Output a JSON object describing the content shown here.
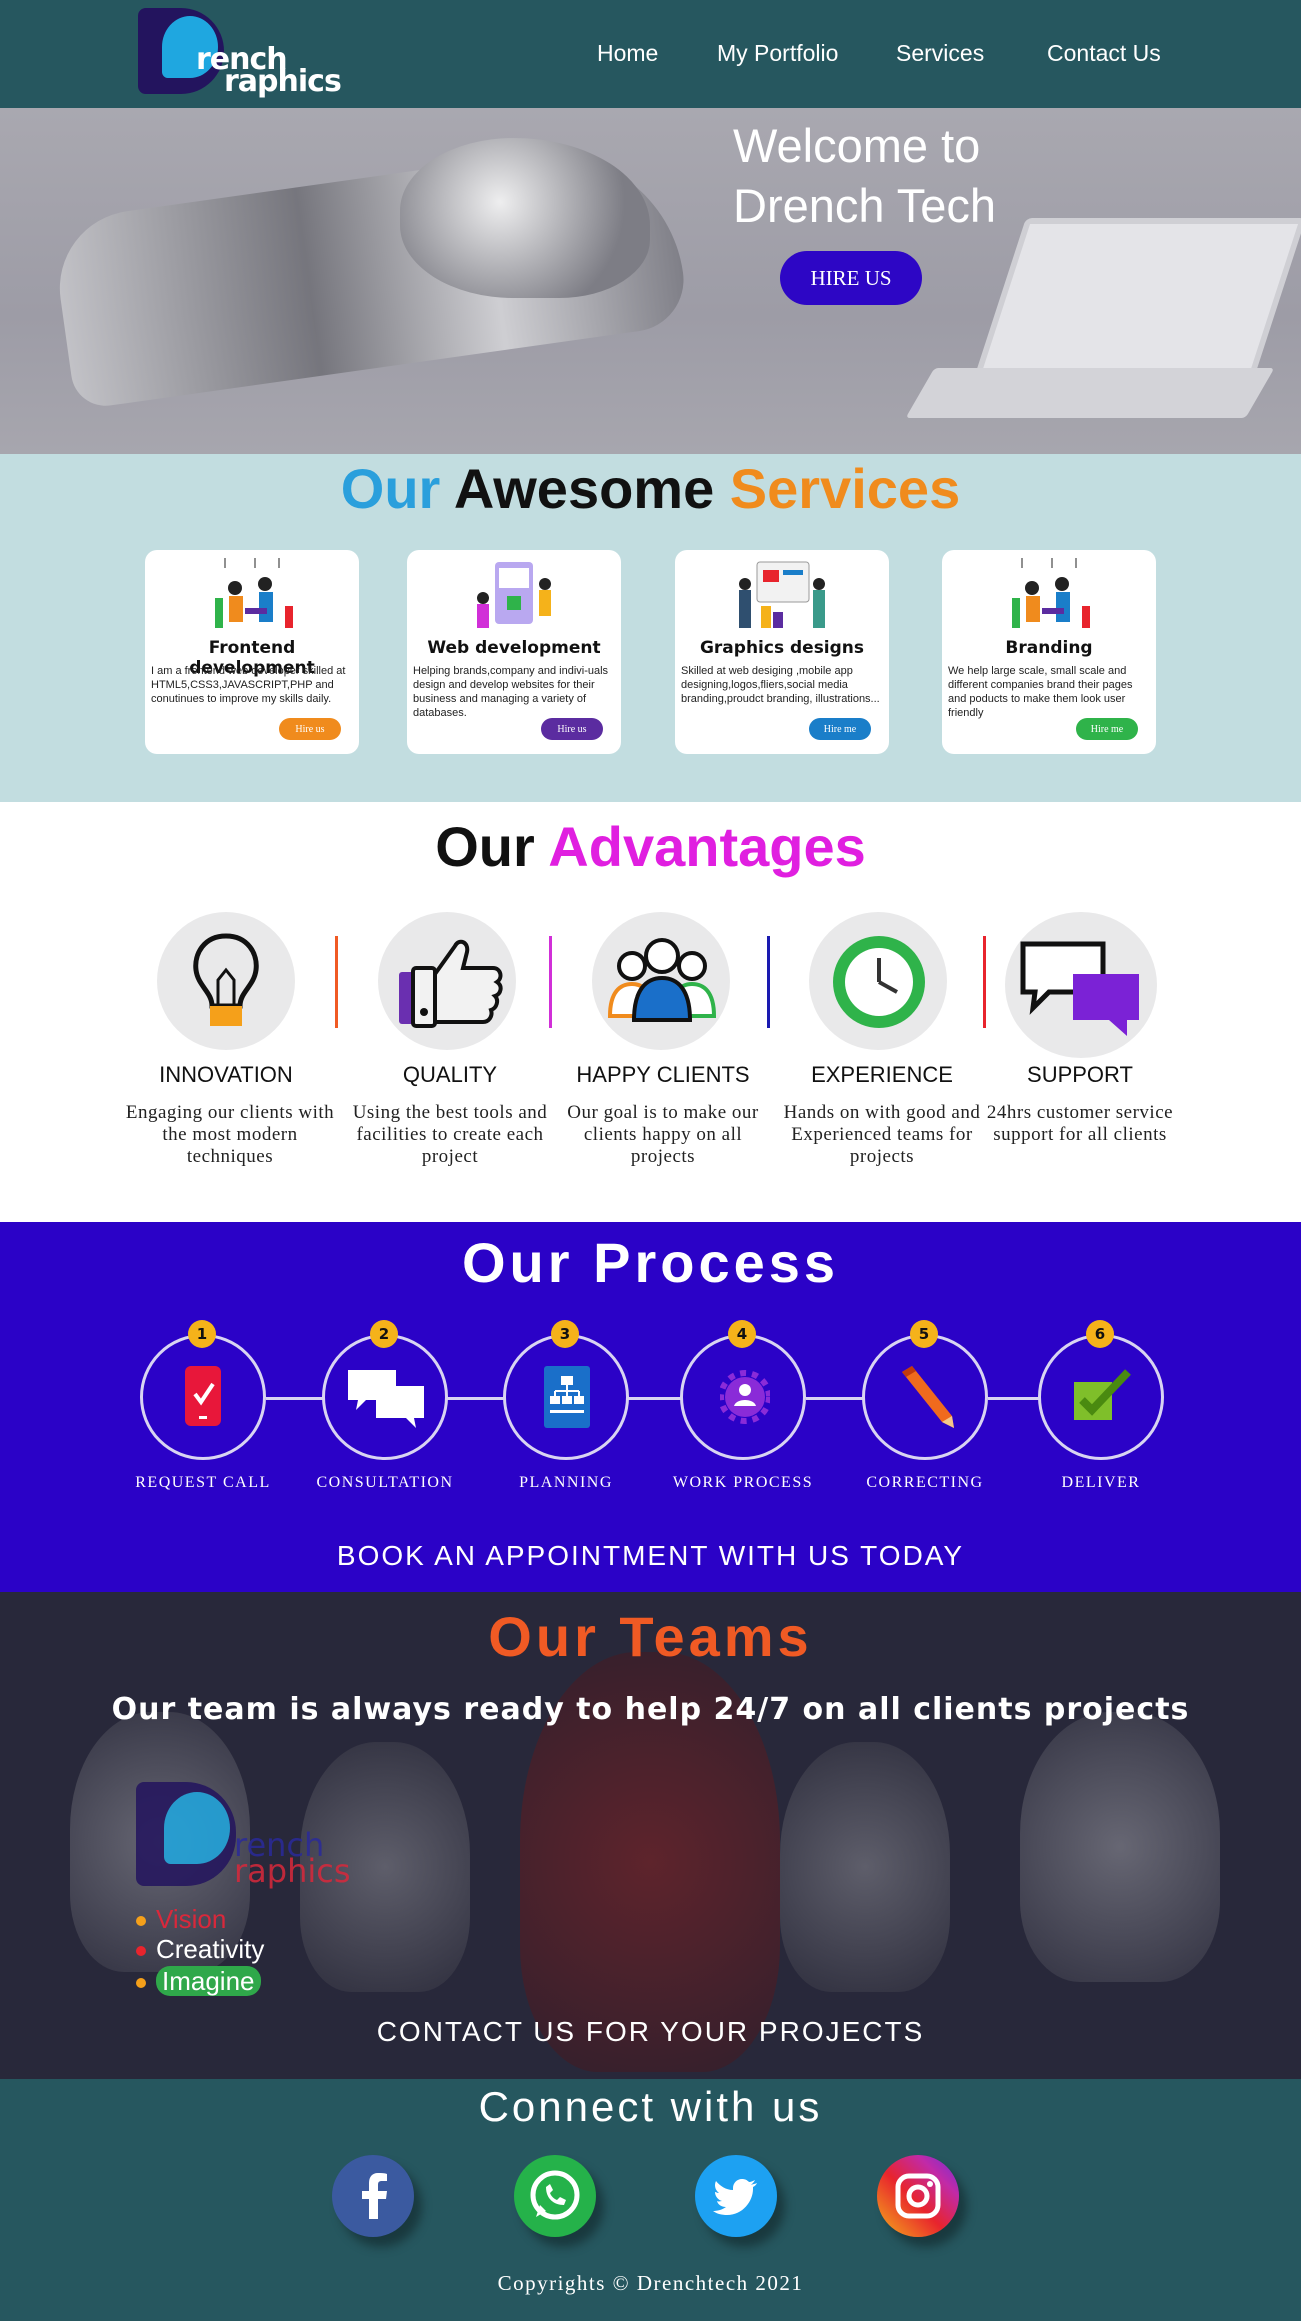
{
  "header": {
    "logo_line1": "rench",
    "logo_line2": "raphics",
    "nav": [
      "Home",
      "My Portfolio",
      "Services",
      "Contact Us"
    ]
  },
  "hero": {
    "title_line1": "Welcome to",
    "title_line2": "Drench Tech",
    "hire_button": "HIRE US"
  },
  "services": {
    "title": {
      "w1": "Our",
      "w2": "Awesome",
      "w3": "Services"
    },
    "cards": [
      {
        "title": "Frontend development",
        "desc": "I am a frontend web developer skilled at HTML5,CSS3,JAVASCRIPT,PHP and conutinues to improve my skills daily.",
        "button": "Hire us",
        "color": "#f08b1d"
      },
      {
        "title": "Web development",
        "desc": "Helping brands,company and indivi-uals design and develop websites for their business and managing a variety of databases.",
        "button": "Hire us",
        "color": "#5b2ca0"
      },
      {
        "title": "Graphics designs",
        "desc": "Skilled at web desiging ,mobile app designing,logos,fliers,social media branding,proudct branding, illustrations...",
        "button": "Hire me",
        "color": "#1a7ec9"
      },
      {
        "title": "Branding",
        "desc": "We help large scale, small scale and different companies brand their pages and poducts to make them look user friendly",
        "button": "Hire me",
        "color": "#2fb34a"
      }
    ]
  },
  "advantages": {
    "title": {
      "w1": "Our",
      "w2": "Advantages"
    },
    "items": [
      {
        "name": "INNOVATION",
        "desc": "Engaging our clients with the most modern techniques",
        "icon": "lightbulb-icon"
      },
      {
        "name": "QUALITY",
        "desc": "Using the best tools and facilities to create each  project",
        "icon": "thumbs-up-icon"
      },
      {
        "name": "HAPPY CLIENTS",
        "desc": "Our goal is to make our clients happy on all projects",
        "icon": "group-icon"
      },
      {
        "name": "EXPERIENCE",
        "desc": "Hands on with good and Experienced teams for projects",
        "icon": "clock-icon"
      },
      {
        "name": "SUPPORT",
        "desc": "24hrs customer service support for all clients",
        "icon": "chat-bubbles-icon"
      }
    ],
    "divider_colors": [
      "#f05a24",
      "#d12fd8",
      "#1a1ab0",
      "#e8242d"
    ]
  },
  "process": {
    "title": "Our Process",
    "steps": [
      {
        "num": "1",
        "label": "REQUEST CALL",
        "icon": "phone-icon"
      },
      {
        "num": "2",
        "label": "CONSULTATION",
        "icon": "chat-icon"
      },
      {
        "num": "3",
        "label": "PLANNING",
        "icon": "sitemap-icon"
      },
      {
        "num": "4",
        "label": "WORK PROCESS",
        "icon": "gear-icon"
      },
      {
        "num": "5",
        "label": "CORRECTING",
        "icon": "pencil-icon"
      },
      {
        "num": "6",
        "label": "DELIVER",
        "icon": "checkbox-icon"
      }
    ],
    "cta": "BOOK AN APPOINTMENT WITH US TODAY"
  },
  "teams": {
    "title": "Our Teams",
    "subtitle": "Our team is always ready to help 24/7 on all clients projects",
    "logo_line1": "rench",
    "logo_line2": "raphics",
    "bullets": [
      "Vision",
      "Creativity",
      "Imagine"
    ],
    "cta": "CONTACT US FOR YOUR PROJECTS"
  },
  "connect": {
    "title": "Connect with us",
    "socials": [
      "facebook-icon",
      "whatsapp-icon",
      "twitter-icon",
      "instagram-icon"
    ],
    "copyright": "Copyrights © Drenchtech 2021"
  }
}
